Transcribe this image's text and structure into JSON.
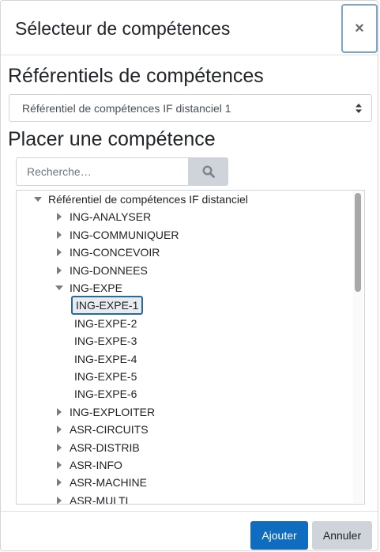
{
  "dialog": {
    "title": "Sélecteur de compétences",
    "close_label": "×"
  },
  "frameworks": {
    "heading": "Référentiels de compétences",
    "selected": "Référentiel de compétences IF distanciel 1"
  },
  "placement": {
    "heading": "Placer une compétence",
    "search_placeholder": "Recherche…"
  },
  "tree": {
    "root": {
      "label": "Référentiel de compétences IF distanciel",
      "expanded": true
    },
    "items": [
      {
        "label": "ING-ANALYSER",
        "expanded": false
      },
      {
        "label": "ING-COMMUNIQUER",
        "expanded": false
      },
      {
        "label": "ING-CONCEVOIR",
        "expanded": false
      },
      {
        "label": "ING-DONNEES",
        "expanded": false
      },
      {
        "label": "ING-EXPE",
        "expanded": true,
        "children": [
          {
            "label": "ING-EXPE-1",
            "selected": true
          },
          {
            "label": "ING-EXPE-2",
            "selected": false
          },
          {
            "label": "ING-EXPE-3",
            "selected": false
          },
          {
            "label": "ING-EXPE-4",
            "selected": false
          },
          {
            "label": "ING-EXPE-5",
            "selected": false
          },
          {
            "label": "ING-EXPE-6",
            "selected": false
          }
        ]
      },
      {
        "label": "ING-EXPLOITER",
        "expanded": false
      },
      {
        "label": "ASR-CIRCUITS",
        "expanded": false
      },
      {
        "label": "ASR-DISTRIB",
        "expanded": false
      },
      {
        "label": "ASR-INFO",
        "expanded": false
      },
      {
        "label": "ASR-MACHINE",
        "expanded": false
      },
      {
        "label": "ASR-MULTI",
        "expanded": false
      }
    ]
  },
  "footer": {
    "add_label": "Ajouter",
    "cancel_label": "Annuler"
  },
  "colors": {
    "primary": "#0f6cbf",
    "secondary": "#ced4da",
    "selected_border": "#2b6a94"
  },
  "icons": {
    "search": "search-icon",
    "expanded": "caret-down-icon",
    "collapsed": "caret-right-icon",
    "select": "select-arrows-icon",
    "close": "close-icon"
  }
}
